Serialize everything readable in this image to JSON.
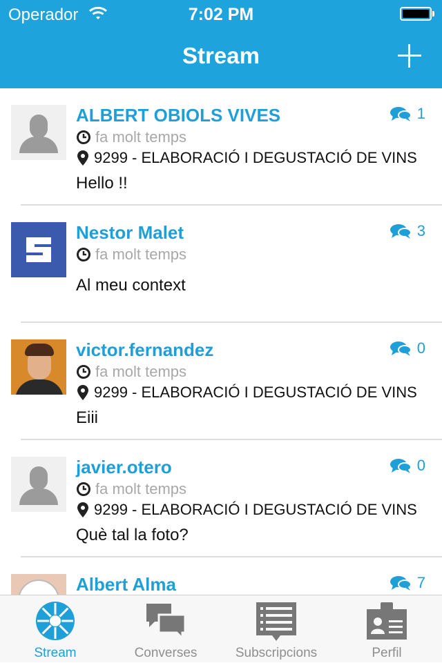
{
  "status_bar": {
    "carrier": "Operador",
    "time": "7:02 PM",
    "battery_percent": 100
  },
  "nav": {
    "title": "Stream",
    "add_icon": "plus-icon"
  },
  "posts": [
    {
      "author": "ALBERT OBIOLS VIVES",
      "comments": "1",
      "time": "fa molt temps",
      "location": "9299 - ELABORACIÓ I DEGUSTACIÓ DE VINS",
      "text": "Hello !!",
      "avatar": "default-avatar"
    },
    {
      "author": "Nestor Malet",
      "comments": "3",
      "time": "fa molt temps",
      "location": "",
      "text": "Al meu context",
      "avatar": "s-logo-avatar"
    },
    {
      "author": "victor.fernandez",
      "comments": "0",
      "time": "fa molt temps",
      "location": "9299 - ELABORACIÓ I DEGUSTACIÓ DE VINS",
      "text": "Eiii",
      "avatar": "photo-avatar"
    },
    {
      "author": "javier.otero",
      "comments": "0",
      "time": "fa molt temps",
      "location": "9299 - ELABORACIÓ I DEGUSTACIÓ DE VINS",
      "text": "Què tal la foto?",
      "avatar": "default-avatar"
    },
    {
      "author": "Albert Alma",
      "comments": "7",
      "time": "",
      "location": "",
      "text": "",
      "avatar": "cartoon-avatar"
    }
  ],
  "tabs": [
    {
      "label": "Stream",
      "icon": "stream-icon",
      "active": true
    },
    {
      "label": "Converses",
      "icon": "chat-bubbles-icon",
      "active": false
    },
    {
      "label": "Subscripcions",
      "icon": "list-icon",
      "active": false
    },
    {
      "label": "Perfil",
      "icon": "profile-card-icon",
      "active": false
    }
  ],
  "colors": {
    "accent": "#1fa3dc",
    "link": "#1f9fd8",
    "muted": "#a8a8a8",
    "tab_inactive": "#8e8e8e"
  }
}
